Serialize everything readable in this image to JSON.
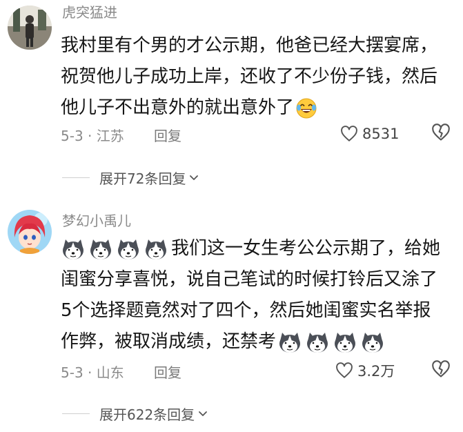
{
  "comments": [
    {
      "username": "虎突猛进",
      "lines": [
        "我村里有个男的才公示期，他爸已经大摆宴席，",
        "祝贺他儿子成功上岸，还收了不少份子钱，然后",
        "他儿子不出意外的就出意外了"
      ],
      "trailing_emoji": "laughing-tears-emoji",
      "date_location": "5-3 · 江苏",
      "reply_label": "回复",
      "like_count": "8531",
      "expand_label": "展开72条回复"
    },
    {
      "username": "梦幻小禹儿",
      "lines": [
        "我们这一女生考公公示期了，给她",
        "闺蜜分享喜悦，说自己笔试的时候打铃后又涂了",
        "5个选择题竟然对了四个，然后她闺蜜实名举报",
        "作弊，被取消成绩，还禁考"
      ],
      "leading_emoji": "husky-dog-emoji",
      "trailing_emoji": "husky-dog-emoji",
      "date_location": "5-3 · 山东",
      "reply_label": "回复",
      "like_count": "3.2万",
      "expand_label": "展开622条回复"
    }
  ],
  "colors": {
    "text": "#161616",
    "meta": "#8a8a8a",
    "divider": "#cfcfcf"
  }
}
